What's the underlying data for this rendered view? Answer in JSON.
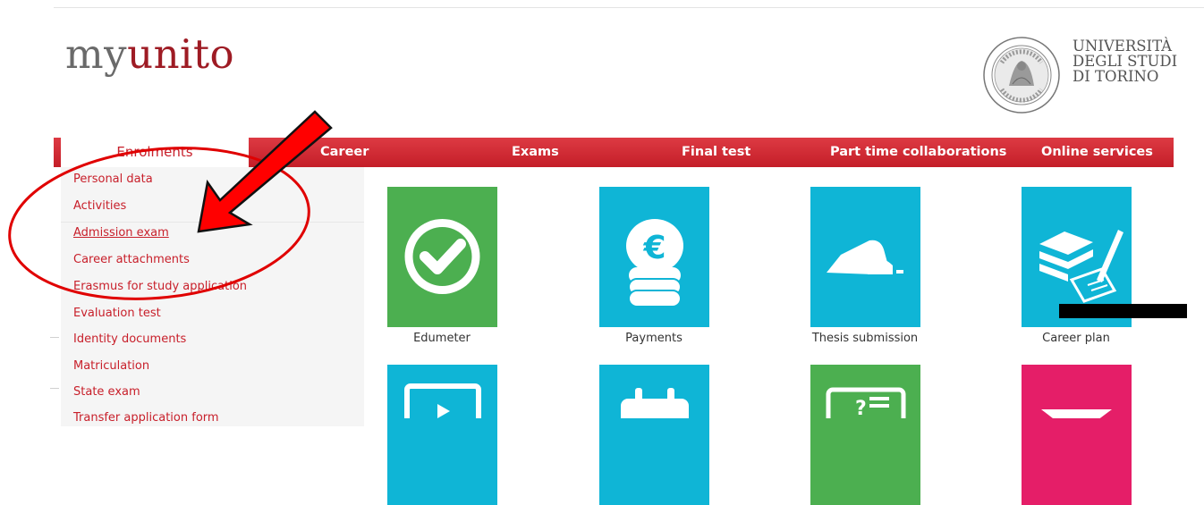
{
  "branding": {
    "logo_my": "my",
    "logo_unito": "unito",
    "university_lines": [
      "UNIVERSITÀ",
      "DEGLI STUDI",
      "DI TORINO"
    ]
  },
  "nav": {
    "items": [
      "Enrolments",
      "Career",
      "Exams",
      "Final test",
      "Part time collaborations",
      "Online services"
    ],
    "active": "Enrolments"
  },
  "sidebar": {
    "items": [
      "Personal data",
      "Activities",
      "Admission exam",
      "Career attachments",
      "Erasmus for study application",
      "Evaluation test",
      "Identity documents",
      "Matriculation",
      "State exam",
      "Transfer application form"
    ],
    "highlighted": "Admission exam"
  },
  "tiles": [
    {
      "label": "Edumeter",
      "color": "#4caf50",
      "icon": "checkmark-icon"
    },
    {
      "label": "Payments",
      "color": "#0fb5d6",
      "icon": "euro-coins-icon"
    },
    {
      "label": "Thesis submission",
      "color": "#0fb5d6",
      "icon": "hand-mouse-icon"
    },
    {
      "label": "Career plan",
      "color": "#0fb5d6",
      "icon": "books-pen-icon"
    }
  ],
  "colors": {
    "brand_red": "#c8202b",
    "annotation_red": "#e00000"
  }
}
